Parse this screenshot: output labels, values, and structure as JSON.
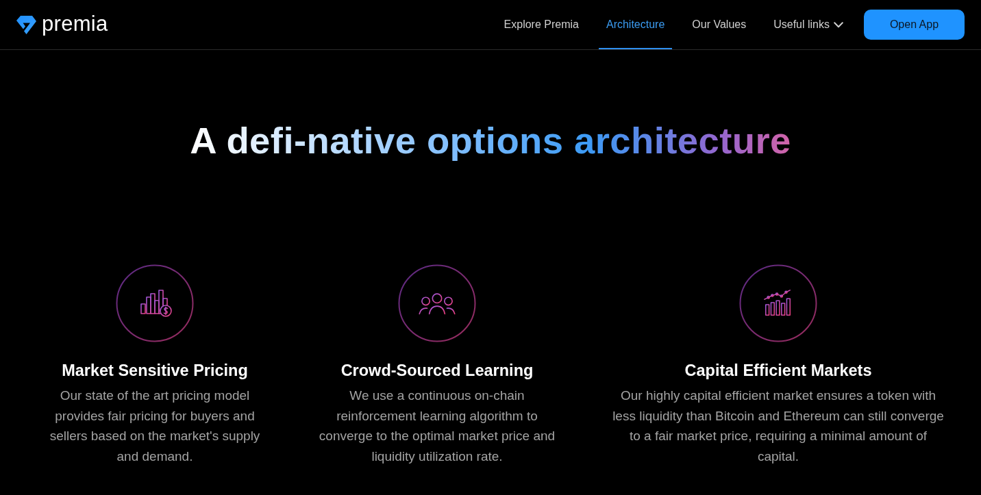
{
  "navbar": {
    "logo_text": "premia",
    "links": [
      {
        "label": "Explore Premia",
        "selected": false,
        "kind": "link"
      },
      {
        "label": "Architecture",
        "selected": true,
        "kind": "link"
      },
      {
        "label": "Our Values",
        "selected": false,
        "kind": "link"
      },
      {
        "label": "Useful links",
        "selected": false,
        "kind": "dropdown"
      }
    ],
    "cta": "Open App"
  },
  "hero": {
    "title": "A defi-native options architecture"
  },
  "features": [
    {
      "title": "Market Sensitive Pricing",
      "text": "Our state of the art pricing model provides fair pricing for buyers and sellers based on the market's supply and demand."
    },
    {
      "title": "Crowd-Sourced Learning",
      "text": "We use a continuous on-chain reinforcement learning algorithm to converge to the optimal market price and liquidity utilization rate."
    },
    {
      "title": "Capital Efficient Markets",
      "text": "Our highly capital efficient market ensures a token with less liquidity than Bitcoin and Ethereum can still converge to a fair market price, requiring a minimal amount of capital."
    }
  ]
}
